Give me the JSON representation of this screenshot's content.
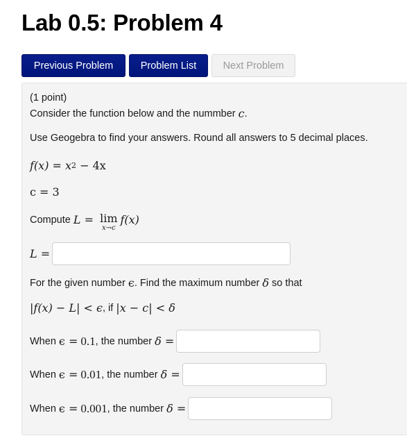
{
  "page": {
    "title": "Lab 0.5: Problem 4"
  },
  "nav": {
    "previous_label": "Previous Problem",
    "list_label": "Problem List",
    "next_label": "Next Problem",
    "colors": {
      "primary": "#0a1e8c",
      "disabled_bg": "#f2f2f2",
      "disabled_text": "#9a9a9a"
    }
  },
  "problem": {
    "points": "(1 point)",
    "intro_text": "Consider the function below and the nummber",
    "intro_var": "c",
    "intro_end": ".",
    "instructions": "Use Geogebra to find your answers. Round all answers to 5 decimal places.",
    "function_lhs": "f(x)",
    "function_eq": " = ",
    "function_rhs_base": "x",
    "function_rhs_exp": "2",
    "function_rhs_rest": " − 4x",
    "c_def": "c = 3",
    "compute_label": "Compute",
    "compute_L": "L",
    "compute_eq": " = ",
    "lim_word": "lim",
    "lim_sub": "x→c",
    "lim_fx": "f(x)",
    "L_label": "L =",
    "L_value": "",
    "delta_intro_a": "For the given number",
    "delta_intro_eps": "ϵ",
    "delta_intro_b": ". Find the maximum number",
    "delta_intro_delta": "δ",
    "delta_intro_c": "so that",
    "condition_a": "|f(x) − L| < ϵ",
    "condition_b": ", if",
    "condition_c": "|x − c| < δ",
    "rows": [
      {
        "when": "When",
        "eps": "ϵ =",
        "value": "0.1",
        "mid": ", the number",
        "delta": "δ =",
        "answer": ""
      },
      {
        "when": "When",
        "eps": "ϵ =",
        "value": "0.01",
        "mid": ", the number",
        "delta": "δ =",
        "answer": ""
      },
      {
        "when": "When",
        "eps": "ϵ =",
        "value": "0.001",
        "mid": ", the number",
        "delta": "δ =",
        "answer": ""
      }
    ]
  }
}
